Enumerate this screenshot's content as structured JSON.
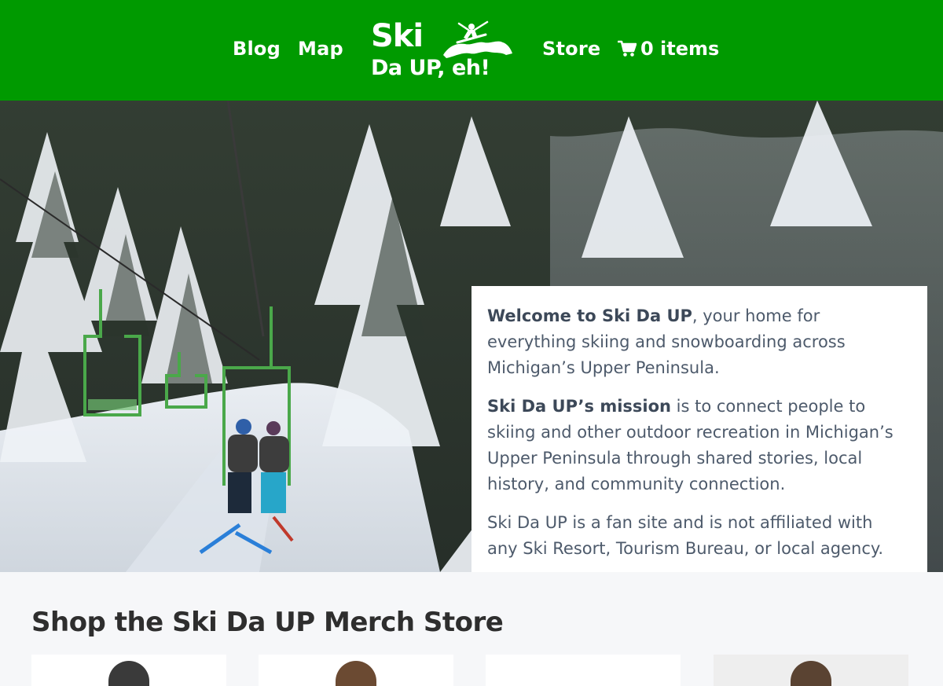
{
  "header": {
    "nav_left": [
      "Blog",
      "Map"
    ],
    "logo": {
      "line1": "Ski",
      "line2": "Da UP, eh!"
    },
    "nav_right": [
      "Store"
    ],
    "cart_label": "0 items",
    "brand_color": "#009a00"
  },
  "intro": {
    "p1_strong": "Welcome to Ski Da UP",
    "p1_text": ", your home for everything skiing and snowboarding across Michigan’s Upper Peninsula.",
    "p2_strong": "Ski Da UP’s mission",
    "p2_text": " is to connect people to skiing and other outdoor recreation in Michigan’s Upper Peninsula through shared stories, local history, and community connection.",
    "p3_text": "Ski Da UP is a fan site and is not affiliated with any Ski Resort, Tourism Bureau, or local agency."
  },
  "store": {
    "heading": "Shop the Ski Da UP Merch Store"
  },
  "icons": {
    "cart": "cart-icon",
    "logo_mark": "skier-icon"
  }
}
